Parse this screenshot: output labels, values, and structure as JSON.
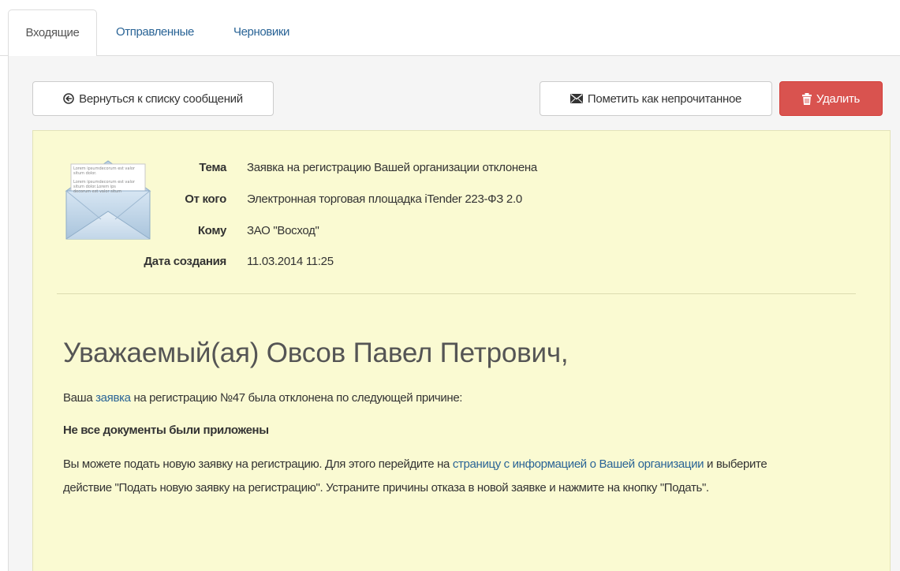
{
  "tabs": [
    {
      "label": "Входящие",
      "active": true
    },
    {
      "label": "Отправленные",
      "active": false
    },
    {
      "label": "Черновики",
      "active": false
    }
  ],
  "toolbar": {
    "back_label": "Вернуться к списку сообщений",
    "mark_unread_label": "Пометить как непрочитанное",
    "delete_label": "Удалить"
  },
  "envelope_letter_lines": [
    "Lorem ipsumdecorum est valor situm dolor.",
    "Lorem ipsumdecorum est valor situm dolor.Lorem ips",
    "decorum est valor situm"
  ],
  "meta": {
    "subject_label": "Тема",
    "subject": "Заявка на регистрацию Вашей организации отклонена",
    "from_label": "От кого",
    "from": "Электронная торговая площадка iTender 223-ФЗ 2.0",
    "to_label": "Кому",
    "to": "ЗАО \"Восход\"",
    "created_label": "Дата создания",
    "created": "11.03.2014 11:25"
  },
  "body": {
    "greeting": "Уважаемый(ая) Овсов Павел Петрович,",
    "line1_before": "Ваша",
    "line1_link": "заявка",
    "line1_after": "на регистрацию №47 была отклонена по следующей причине:",
    "reason": "Не все документы были приложены",
    "line2_before": "Вы можете подать новую заявку на регистрацию. Для этого перейдите на",
    "line2_link": "страницу с информацией о Вашей организации",
    "line2_after": "и выберите",
    "line3": "действие \"Подать новую заявку на регистрацию\". Устраните причины отказа в новой заявке и нажмите на кнопку \"Подать\"."
  },
  "colors": {
    "link": "#2a6496",
    "danger": "#d9534f",
    "message_bg": "#fafad2"
  }
}
